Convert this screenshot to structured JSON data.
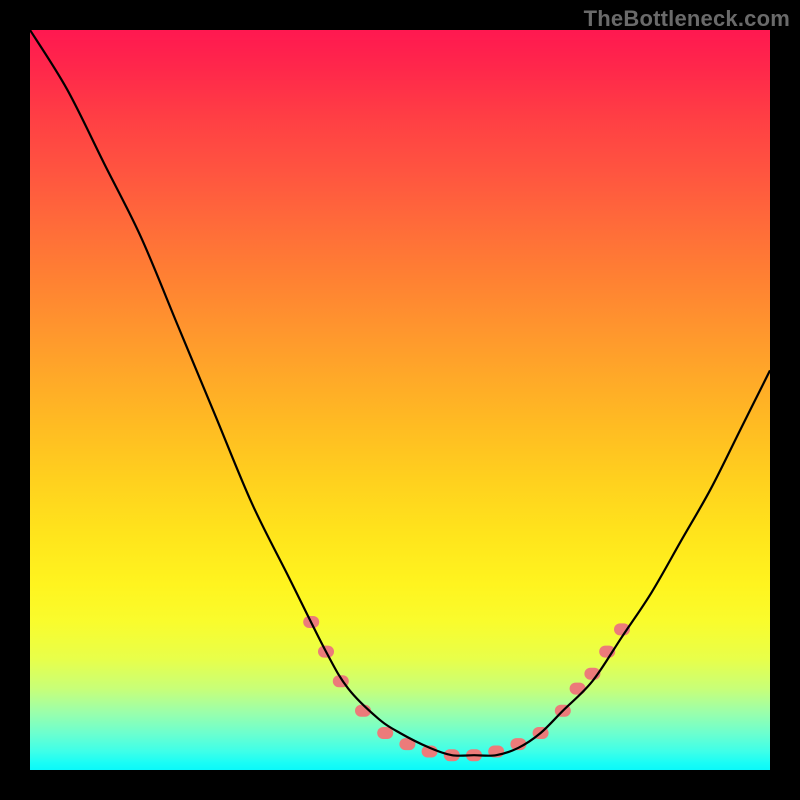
{
  "attribution": "TheBottleneck.com",
  "chart_data": {
    "type": "line",
    "title": "",
    "xlabel": "",
    "ylabel": "",
    "xlim": [
      0,
      100
    ],
    "ylim": [
      0,
      100
    ],
    "series": [
      {
        "name": "bottleneck-curve",
        "x": [
          0,
          5,
          10,
          15,
          20,
          25,
          30,
          35,
          40,
          43,
          47,
          50,
          54,
          57,
          60,
          63,
          66,
          69,
          72,
          76,
          80,
          84,
          88,
          92,
          96,
          100
        ],
        "values": [
          100,
          92,
          82,
          72,
          60,
          48,
          36,
          26,
          16,
          11,
          7,
          5,
          3,
          2,
          2,
          2,
          3,
          5,
          8,
          12,
          18,
          24,
          31,
          38,
          46,
          54
        ]
      }
    ],
    "markers": {
      "name": "highlighted-points",
      "shape": "rounded-rect",
      "color": "#ec7b7a",
      "points": [
        {
          "x": 38,
          "y": 20
        },
        {
          "x": 40,
          "y": 16
        },
        {
          "x": 42,
          "y": 12
        },
        {
          "x": 45,
          "y": 8
        },
        {
          "x": 48,
          "y": 5
        },
        {
          "x": 51,
          "y": 3.5
        },
        {
          "x": 54,
          "y": 2.5
        },
        {
          "x": 57,
          "y": 2
        },
        {
          "x": 60,
          "y": 2
        },
        {
          "x": 63,
          "y": 2.5
        },
        {
          "x": 66,
          "y": 3.5
        },
        {
          "x": 69,
          "y": 5
        },
        {
          "x": 72,
          "y": 8
        },
        {
          "x": 74,
          "y": 11
        },
        {
          "x": 76,
          "y": 13
        },
        {
          "x": 78,
          "y": 16
        },
        {
          "x": 80,
          "y": 19
        }
      ]
    },
    "gradient_stops": [
      {
        "pos": 0.0,
        "color": "#ff1850"
      },
      {
        "pos": 0.5,
        "color": "#ffbf25"
      },
      {
        "pos": 0.8,
        "color": "#f9fc2d"
      },
      {
        "pos": 0.95,
        "color": "#6dffce"
      },
      {
        "pos": 1.0,
        "color": "#0af9fa"
      }
    ]
  }
}
